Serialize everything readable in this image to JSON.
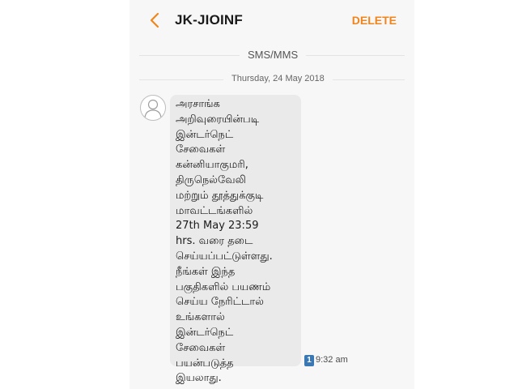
{
  "header": {
    "title": "JK-JIOINF",
    "delete_label": "DELETE",
    "back_icon": "chevron-left-icon",
    "accent_color": "#f0851c"
  },
  "thread": {
    "type_label": "SMS/MMS",
    "date_label": "Thursday, 24 May 2018"
  },
  "message": {
    "avatar_icon": "person-icon",
    "lines": [
      "அரசாங்க",
      "அறிவுரையின்படி",
      "இன்டர்நெட்",
      "சேவைகள்",
      "கன்னியாகுமரி,",
      "திருநெல்வேலி",
      "மற்றும் தூத்துக்குடி",
      "மாவட்டங்களில்",
      "27th May 23:59",
      "hrs. வரை தடை",
      "செய்யப்பட்டுள்ளது.",
      "நீங்கள் இந்த",
      "பகுதிகளில் பயணம்",
      "செய்ய நேரிட்டால்",
      "உங்களால்",
      "இன்டர்நெட்",
      "சேவைகள்",
      "பயன்படுத்த",
      "இயலாது."
    ],
    "sim_number": "1",
    "time": "9:32 am"
  }
}
